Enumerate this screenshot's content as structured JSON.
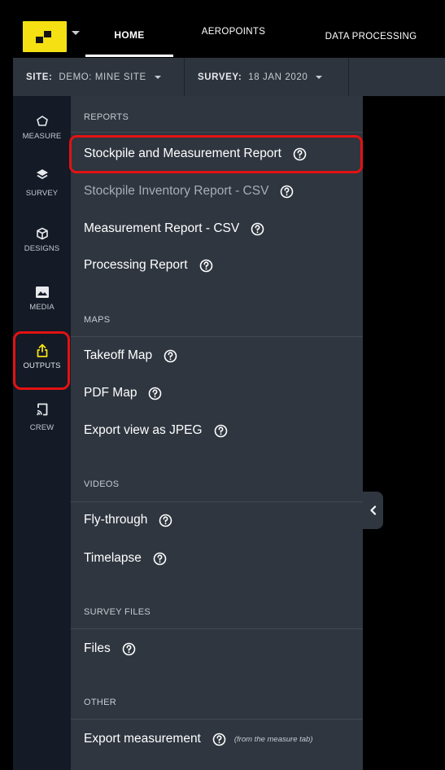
{
  "header": {
    "tabs": [
      {
        "label": "HOME",
        "active": true
      },
      {
        "label": "AEROPOINTS"
      },
      {
        "label": "DATA PROCESSING"
      }
    ],
    "brand_color": "#f5e013"
  },
  "sitebar": {
    "site_label": "SITE:",
    "site_value": "DEMO: MINE SITE",
    "survey_label": "SURVEY:",
    "survey_value": "18 JAN 2020"
  },
  "rail": {
    "items": [
      {
        "label": "MEASURE",
        "icon": "pentagon-icon"
      },
      {
        "label": "SURVEY",
        "icon": "layers-icon"
      },
      {
        "label": "DESIGNS",
        "icon": "cube-icon"
      },
      {
        "label": "MEDIA",
        "icon": "image-icon"
      },
      {
        "label": "OUTPUTS",
        "icon": "share-upload-icon",
        "active": true,
        "accent": "#f5e013"
      },
      {
        "label": "CREW",
        "icon": "cast-icon"
      }
    ]
  },
  "panel": {
    "sections": [
      {
        "title": "REPORTS",
        "items": [
          {
            "label": "Stockpile and Measurement Report"
          },
          {
            "label": "Stockpile Inventory Report - CSV",
            "dimmed": true
          },
          {
            "label": "Measurement Report - CSV"
          },
          {
            "label": "Processing Report"
          }
        ]
      },
      {
        "title": "MAPS",
        "items": [
          {
            "label": "Takeoff Map"
          },
          {
            "label": "PDF Map"
          },
          {
            "label": "Export view as JPEG"
          }
        ]
      },
      {
        "title": "VIDEOS",
        "items": [
          {
            "label": "Fly-through"
          },
          {
            "label": "Timelapse"
          }
        ]
      },
      {
        "title": "SURVEY FILES",
        "items": [
          {
            "label": "Files"
          }
        ]
      },
      {
        "title": "OTHER",
        "items": [
          {
            "label": "Export measurement",
            "note": "(from the measure tab)"
          }
        ]
      }
    ]
  },
  "annotations": {
    "highlight_color": "#e31212"
  }
}
